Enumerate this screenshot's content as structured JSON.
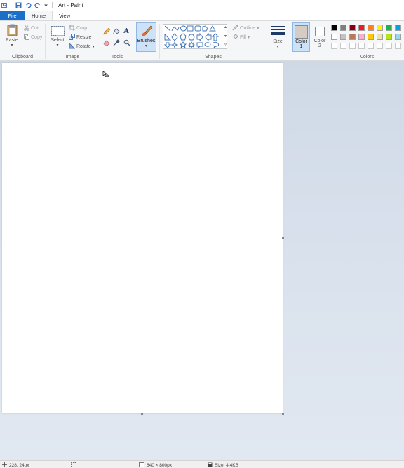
{
  "window": {
    "title": "Art - Paint"
  },
  "tabs": {
    "file": "File",
    "home": "Home",
    "view": "View"
  },
  "clipboard": {
    "paste": "Paste",
    "cut": "Cut",
    "copy": "Copy",
    "label": "Clipboard"
  },
  "image": {
    "select": "Select",
    "crop": "Crop",
    "resize": "Resize",
    "rotate": "Rotate",
    "label": "Image"
  },
  "tools": {
    "label": "Tools",
    "text_glyph": "A"
  },
  "brushes": {
    "label": "Brushes"
  },
  "shapes": {
    "outline": "Outline",
    "fill": "Fill",
    "label": "Shapes"
  },
  "size": {
    "label": "Size"
  },
  "color1": {
    "label": "Color",
    "num": "1",
    "value": "#d5ccc5"
  },
  "color2": {
    "label": "Color",
    "num": "2",
    "value": "#ffffff"
  },
  "colors": {
    "label": "Colors",
    "row1": [
      "#000000",
      "#7f7f7f",
      "#880015",
      "#ed1c24",
      "#ff7f27",
      "#fff200",
      "#22b14c",
      "#00a2e8"
    ],
    "row2": [
      "#ffffff",
      "#c3c3c3",
      "#b97a57",
      "#ffaec9",
      "#ffc90e",
      "#efe4b0",
      "#b5e61d",
      "#99d9ea"
    ],
    "row3": [
      "#ffffff",
      "#ffffff",
      "#ffffff",
      "#ffffff",
      "#ffffff",
      "#ffffff",
      "#ffffff",
      "#ffffff"
    ]
  },
  "status": {
    "cursor_pos": "228, 24px",
    "selection_size": "",
    "canvas_size": "640 × 800px",
    "file_size": "Size: 4.4KB"
  }
}
